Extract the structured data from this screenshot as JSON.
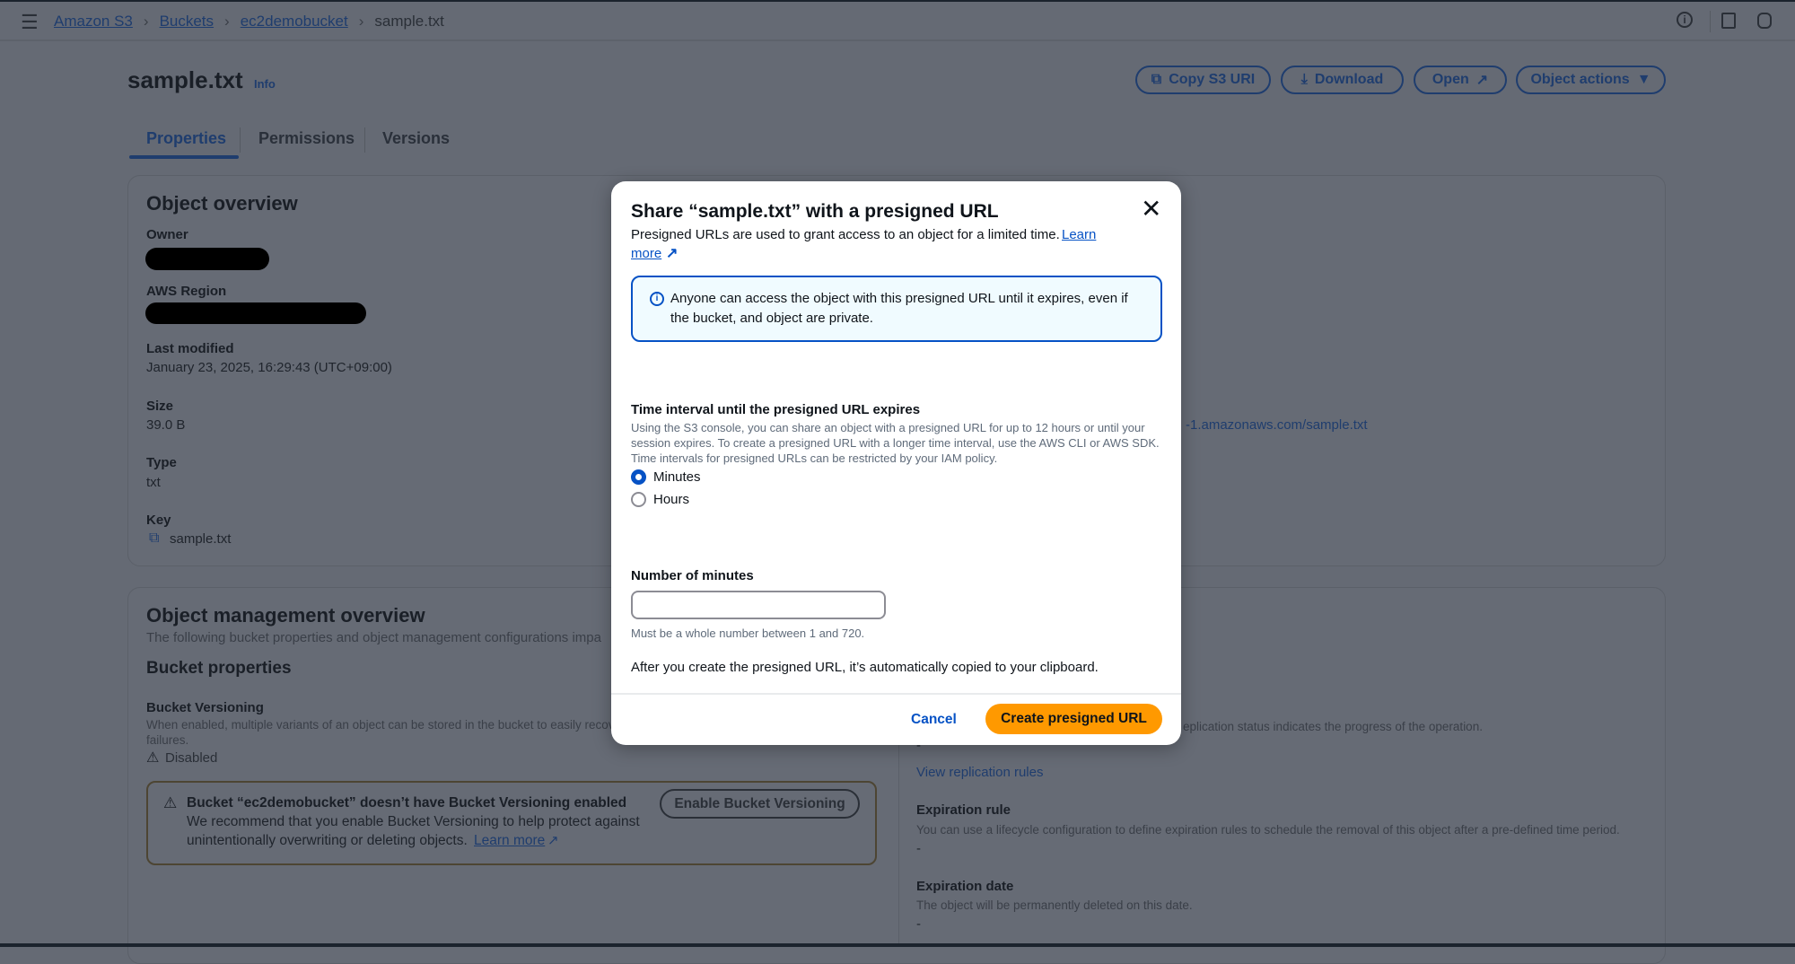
{
  "breadcrumb": [
    {
      "label": "Amazon S3"
    },
    {
      "label": "Buckets"
    },
    {
      "label": "ec2demobucket"
    },
    {
      "label": "sample.txt"
    }
  ],
  "header": {
    "title": "sample.txt",
    "info": "Info"
  },
  "actions": {
    "copy": "Copy S3 URI",
    "download": "Download",
    "open": "Open",
    "object_actions": "Object actions"
  },
  "tabs": [
    {
      "label": "Properties",
      "active": true
    },
    {
      "label": "Permissions"
    },
    {
      "label": "Versions"
    }
  ],
  "overview": {
    "title": "Object overview",
    "owner_label": "Owner",
    "region_label": "AWS Region",
    "last_modified_label": "Last modified",
    "last_modified": "January 23, 2025, 16:29:43 (UTC+09:00)",
    "size_label": "Size",
    "size": "39.0 B",
    "type_label": "Type",
    "type": "txt",
    "key_label": "Key",
    "key": "sample.txt",
    "url_fragment": "-1.amazonaws.com/sample.txt"
  },
  "management": {
    "title": "Object management overview",
    "subtitle": "The following bucket properties and object management configurations impa",
    "bucket_properties": "Bucket properties",
    "versioning_label": "Bucket Versioning",
    "versioning_desc_1": "When enabled, multiple variants of an object can be stored in the bucket to easily recove",
    "versioning_desc_2": "failures.",
    "versioning_status": "Disabled",
    "alert_title": "Bucket “ec2demobucket” doesn’t have Bucket Versioning enabled",
    "alert_line1": "We recommend that you enable Bucket Versioning to help protect against",
    "alert_line2": "unintentionally overwriting or deleting objects.",
    "alert_link": "Learn more",
    "enable_button": "Enable Bucket Versioning",
    "replication_desc": "eplication status indicates the progress of the operation.",
    "replication_value": "-",
    "view_replication": "View replication rules",
    "expiration_rule_label": "Expiration rule",
    "expiration_rule_desc": "You can use a lifecycle configuration to define expiration rules to schedule the removal of this object after a pre-defined time period.",
    "expiration_rule_value": "-",
    "expiration_date_label": "Expiration date",
    "expiration_date_desc": "The object will be permanently deleted on this date.",
    "expiration_date_value": "-"
  },
  "modal": {
    "title": "Share “sample.txt” with a presigned URL",
    "desc": "Presigned URLs are used to grant access to an object for a limited time.",
    "learn": "Learn",
    "more": "more",
    "info_line1": "Anyone can access the object with this presigned URL until it expires, even if",
    "info_line2": "the bucket, and object are private.",
    "interval_label": "Time interval until the presigned URL expires",
    "interval_desc1": "Using the S3 console, you can share an object with a presigned URL for up to 12 hours or until your",
    "interval_desc2": "session expires. To create a presigned URL with a longer time interval, use the AWS CLI or AWS SDK.",
    "interval_desc3": "Time intervals for presigned URLs can be restricted by your IAM policy.",
    "options": [
      {
        "label": "Minutes",
        "selected": true
      },
      {
        "label": "Hours",
        "selected": false
      }
    ],
    "minutes_label": "Number of minutes",
    "minutes_value": "",
    "minutes_hint": "Must be a whole number between 1 and 720.",
    "clipboard_note": "After you create the presigned URL, it’s automatically copied to your clipboard.",
    "cancel": "Cancel",
    "create": "Create presigned URL"
  },
  "colors": {
    "primary": "#0652c5",
    "create_button": "#ff9900",
    "overlay": "#656a74"
  }
}
